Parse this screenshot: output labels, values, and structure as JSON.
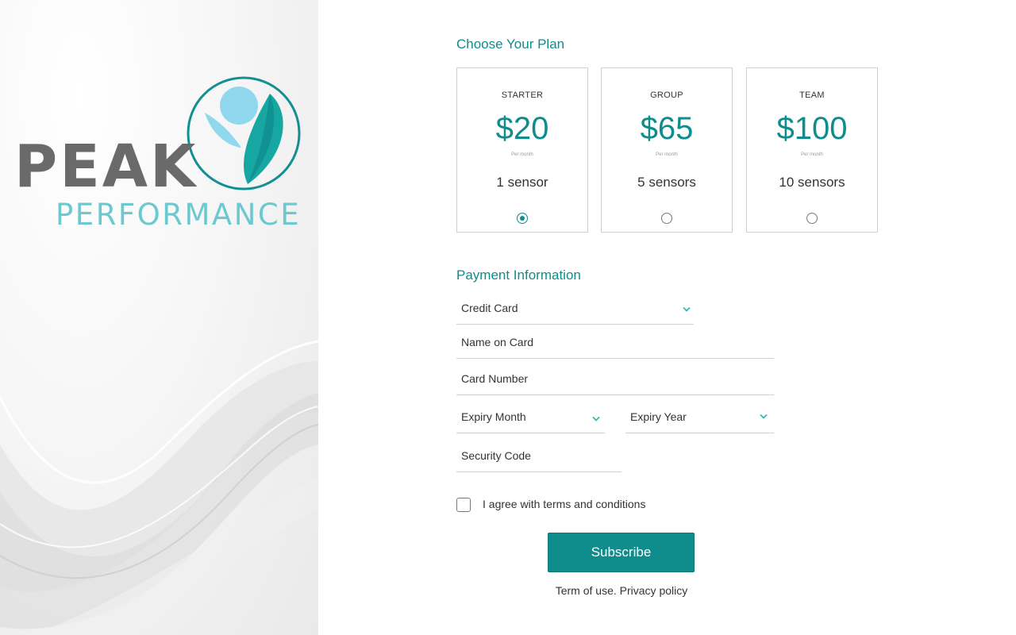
{
  "brand": {
    "logo_line1": "PEAK",
    "logo_line2": "PERFORMANCE",
    "colors": {
      "grey": "#6a6a6a",
      "teal_light": "#6cc9cf",
      "teal_dark": "#0f8c8c",
      "sky": "#8fd8ee"
    }
  },
  "plans": {
    "title": "Choose Your Plan",
    "items": [
      {
        "name": "STARTER",
        "price": "$20",
        "period": "Per month",
        "sensors": "1 sensor",
        "selected": true
      },
      {
        "name": "GROUP",
        "price": "$65",
        "period": "Per month",
        "sensors": "5 sensors",
        "selected": false
      },
      {
        "name": "TEAM",
        "price": "$100",
        "period": "Per month",
        "sensors": "10 sensors",
        "selected": false
      }
    ]
  },
  "payment": {
    "title": "Payment Information",
    "method": {
      "value": "Credit Card",
      "icon": "chevron-down-icon"
    },
    "name_on_card": {
      "placeholder": "Name on Card"
    },
    "card_number": {
      "placeholder": "Card Number"
    },
    "expiry_month": {
      "placeholder": "Expiry Month",
      "icon": "chevron-down-icon"
    },
    "expiry_year": {
      "placeholder": "Expiry Year",
      "icon": "chevron-down-icon"
    },
    "security_code": {
      "placeholder": "Security Code"
    }
  },
  "agreement": {
    "label": "I agree with terms and conditions",
    "checked": false
  },
  "subscribe_button": {
    "label": "Subscribe"
  },
  "footer": {
    "terms": "Term of use.",
    "privacy": "Privacy policy"
  },
  "colors": {
    "accent": "#0f8c8c",
    "chevron": "#35b5b9",
    "border": "#cfcfcf"
  }
}
